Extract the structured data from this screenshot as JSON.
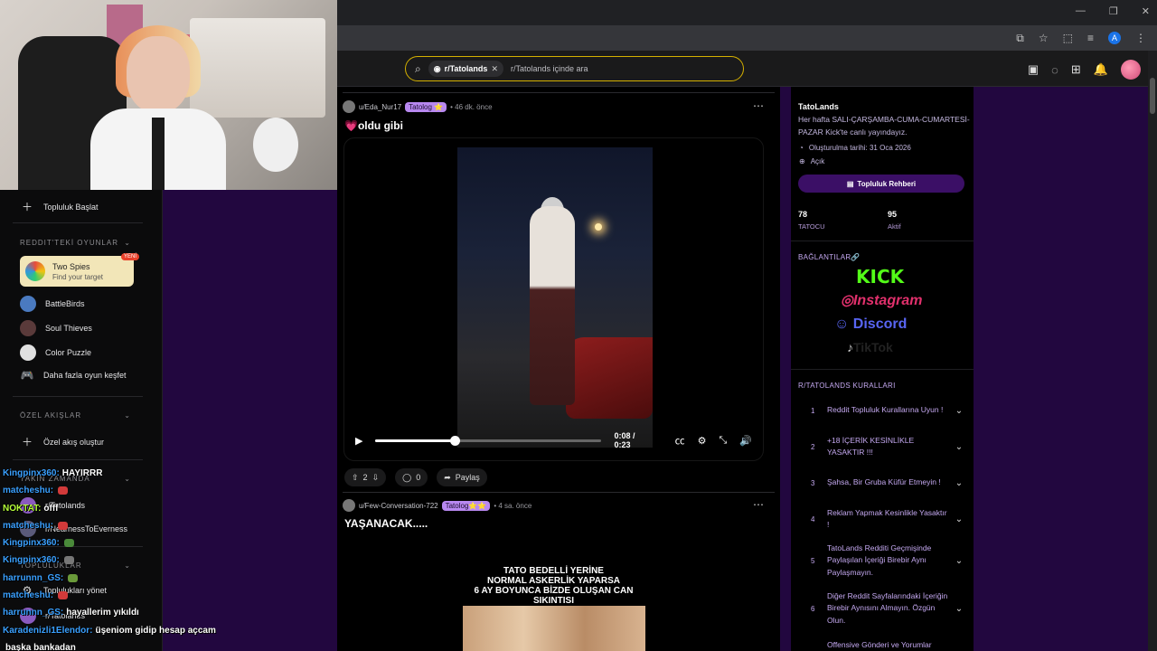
{
  "browser": {
    "window_controls": [
      "—",
      "❐",
      "✕"
    ],
    "profile_initial": "A"
  },
  "header": {
    "search_chip": "r/Tatolands",
    "search_chip_close": "✕",
    "search_placeholder": "r/Tatolands içinde ara"
  },
  "sidebar": {
    "start_community": "Topluluk Başlat",
    "games_header": "REDDIT'TEKİ OYUNLAR",
    "featured_game": {
      "name": "Two Spies",
      "tagline": "Find your target",
      "badge": "YENİ"
    },
    "games": [
      {
        "name": "BattleBirds"
      },
      {
        "name": "Soul Thieves"
      },
      {
        "name": "Color Puzzle"
      }
    ],
    "discover_more": "Daha fazla oyun keşfet",
    "custom_feeds_header": "ÖZEL AKIŞLAR",
    "create_feed": "Özel akış oluştur",
    "recent_header": "YAKIN ZAMANDA",
    "recent_items": [
      "r/Tatolands",
      "r/NearnessToEverness"
    ],
    "communities_header": "TOPLULUKLAR",
    "manage_communities": "Toplulukları yönet",
    "community_item": "r/Tatolands"
  },
  "chat": [
    {
      "user": "Kingpinx360:",
      "msg": "HAYIRRR",
      "color": "#3aa0ff"
    },
    {
      "user": "matcheshu:",
      "msg": "",
      "color": "#3aa0ff",
      "emote": "#d23a3a"
    },
    {
      "user": "NOKTAT:",
      "msg": "offf",
      "color": "#b6ff3a"
    },
    {
      "user": "matcheshu:",
      "msg": "",
      "color": "#3aa0ff",
      "emote": "#d23a3a"
    },
    {
      "user": "Kingpinx360:",
      "msg": "",
      "color": "#3aa0ff",
      "emote": "#4a8a3a"
    },
    {
      "user": "Kingpinx360:",
      "msg": "",
      "color": "#3aa0ff",
      "emote": "#777777"
    },
    {
      "user": "harrunnn_GS:",
      "msg": "",
      "color": "#3aa0ff",
      "emote": "#6a9a3a"
    },
    {
      "user": "matcheshu:",
      "msg": "",
      "color": "#3aa0ff",
      "emote": "#d23a3a"
    },
    {
      "user": "harrunnn_GS:",
      "msg": "hayallerim yıkıldı",
      "color": "#3aa0ff"
    },
    {
      "user": "Karadenizli1Elendor:",
      "msg": "üşeniom gidip hesap açcam",
      "color": "#3aa0ff"
    },
    {
      "user": "",
      "msg": "başka bankadan",
      "color": "#3aa0ff"
    }
  ],
  "posts": [
    {
      "author": "u/Eda_Nur17",
      "flair": "Tatolog ⭐",
      "time": "• 46 dk. önce",
      "title": "💗oldu gibi",
      "video_time": "0:08 / 0:23",
      "video_progress": 0.35,
      "votes": "2",
      "comments": "0",
      "share": "Paylaş"
    },
    {
      "author": "u/Few-Conversation-722",
      "flair": "Tatolog⭐⭐",
      "time": "• 4 sa. önce",
      "title": "YAŞANACAK.....",
      "image_caption": "TATO BEDELLİ YERİNE\nNORMAL ASKERLİK YAPARSA\n6 AY BOYUNCA BİZDE OLUŞAN CAN\nSIKINTISI"
    }
  ],
  "community": {
    "name": "TatoLands",
    "description": "Her hafta SALI-ÇARŞAMBA-CUMA-CUMARTESİ-PAZAR Kick'te canlı yayındayız.",
    "created": "Oluşturulma tarihi: 31 Oca 2026",
    "visibility": "Açık",
    "guide_button": "Topluluk Rehberi",
    "members": {
      "value": "78",
      "label": "TATOCU"
    },
    "active": {
      "value": "95",
      "label": "Aktif"
    },
    "links_header": "BAĞLANTILAR🔗",
    "links": [
      "KICK",
      "Instagram",
      "Discord",
      "TikTok"
    ],
    "rules_header": "R/TATOLANDS KURALLARI",
    "rules": [
      {
        "num": "1",
        "text": "Reddit Topluluk Kurallarına Uyun !"
      },
      {
        "num": "2",
        "text": "+18 İÇERİK KESİNLİKLE YASAKTIR !!!"
      },
      {
        "num": "3",
        "text": "Şahsa, Bir Gruba Küfür Etmeyin !"
      },
      {
        "num": "4",
        "text": "Reklam Yapmak Kesinlikle Yasaktır !"
      },
      {
        "num": "5",
        "text": "TatoLands Redditi Geçmişinde Paylaşılan İçeriği Birebir Aynı Paylaşmayın."
      },
      {
        "num": "6",
        "text": "Diğer Reddit Sayfalarındaki İçeriğin Birebir Aynısını Almayın. Özgün Olun."
      },
      {
        "num": "",
        "text": "Offensive Gönderi ve Yorumlar"
      }
    ]
  },
  "colors": {
    "backdrop": "#22073f",
    "flair": "#b888f0",
    "search_border": "#d4b000",
    "kick_green": "#53fc18",
    "discord_blue": "#5865f2"
  }
}
